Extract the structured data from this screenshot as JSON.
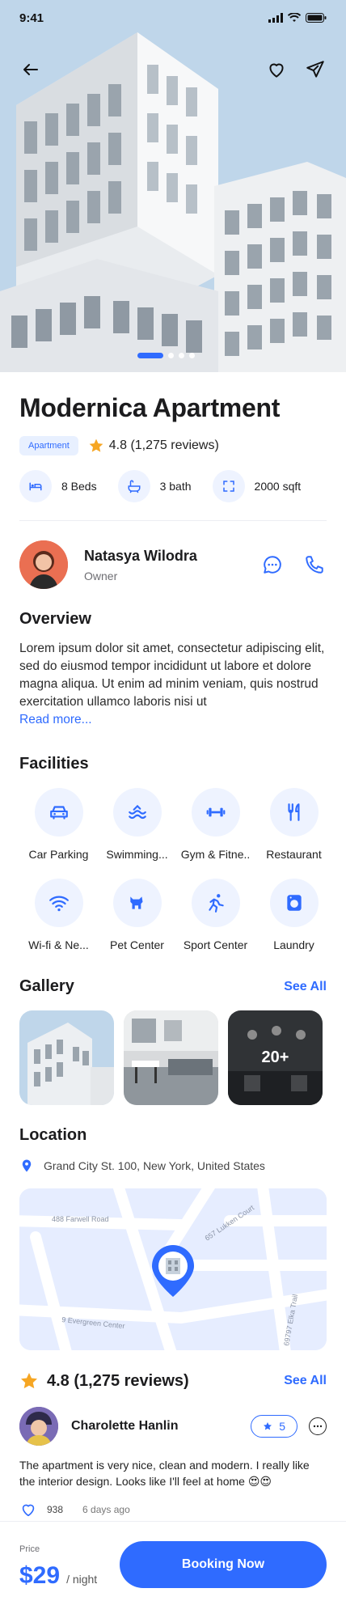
{
  "status_bar": {
    "time": "9:41"
  },
  "hero": {
    "image": "apartment-building-photo",
    "pager": {
      "count": 4,
      "active": 0
    }
  },
  "property": {
    "title": "Modernica Apartment",
    "tag": "Apartment",
    "rating_text": "4.8 (1,275 reviews)",
    "specs": [
      {
        "icon": "bed-icon",
        "label": "8 Beds"
      },
      {
        "icon": "bath-icon",
        "label": "3 bath"
      },
      {
        "icon": "area-icon",
        "label": "2000 sqft"
      }
    ]
  },
  "owner": {
    "name": "Natasya Wilodra",
    "role": "Owner"
  },
  "overview": {
    "title": "Overview",
    "text": "Lorem ipsum dolor sit amet, consectetur adipiscing elit, sed do eiusmod tempor incididunt ut labore et dolore magna aliqua. Ut enim ad minim veniam, quis nostrud exercitation ullamco laboris nisi ut",
    "read_more": "Read more..."
  },
  "facilities": {
    "title": "Facilities",
    "items": [
      {
        "icon": "car-icon",
        "label": "Car Parking"
      },
      {
        "icon": "swimming-icon",
        "label": "Swimming..."
      },
      {
        "icon": "gym-icon",
        "label": "Gym & Fitne.."
      },
      {
        "icon": "restaurant-icon",
        "label": "Restaurant"
      },
      {
        "icon": "wifi-icon",
        "label": "Wi-fi & Ne..."
      },
      {
        "icon": "pet-icon",
        "label": "Pet Center"
      },
      {
        "icon": "sport-icon",
        "label": "Sport Center"
      },
      {
        "icon": "laundry-icon",
        "label": "Laundry"
      }
    ]
  },
  "gallery": {
    "title": "Gallery",
    "see_all": "See All",
    "more_count": "20+"
  },
  "location": {
    "title": "Location",
    "address": "Grand City St. 100, New York, United States",
    "streets": [
      "488 Farwell Road",
      "657 Lukken Court",
      "9 Evergreen Center",
      "69797 Elka Trail"
    ]
  },
  "reviews": {
    "rating_text": "4.8 (1,275 reviews)",
    "see_all": "See All",
    "items": [
      {
        "name": "Charolette Hanlin",
        "stars": "5",
        "text": "The apartment is very nice, clean and modern. I really like the interior design. Looks like I'll feel at home 😍😍",
        "likes": "938",
        "time": "6 days ago"
      }
    ]
  },
  "booking": {
    "price_label": "Price",
    "price": "$29",
    "unit": "/ night",
    "button": "Booking Now"
  },
  "colors": {
    "accent": "#2f6bff",
    "accent_light": "#eef3ff",
    "star": "#f6a623"
  }
}
